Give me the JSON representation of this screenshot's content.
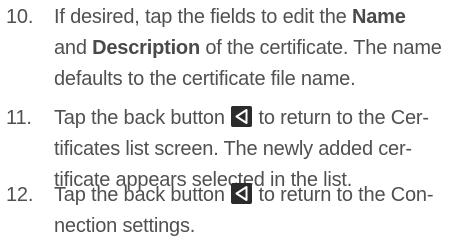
{
  "steps": [
    {
      "number": "10.",
      "line1_prefix": "If desired, tap the fields to edit the ",
      "name_label": "Name",
      "line2_and": "and ",
      "description_label": "Description",
      "line2_suffix": " of the certificate. The name",
      "line3": "defaults to the certificate file name."
    },
    {
      "number": "11.",
      "line1_prefix": "Tap the back button ",
      "line1_suffix": " to return to the Cer-",
      "line2": "tificates list screen. The newly added cer-",
      "line3": "tificate appears selected in the list."
    },
    {
      "number": "12.",
      "line1_prefix": "Tap the back button ",
      "line1_suffix": " to return to the Con-",
      "line2": "nection settings."
    }
  ],
  "icons": {
    "back": "back-triangle-icon",
    "back_icon_bg": "#2b2b2b",
    "back_icon_fg": "#ffffff"
  }
}
